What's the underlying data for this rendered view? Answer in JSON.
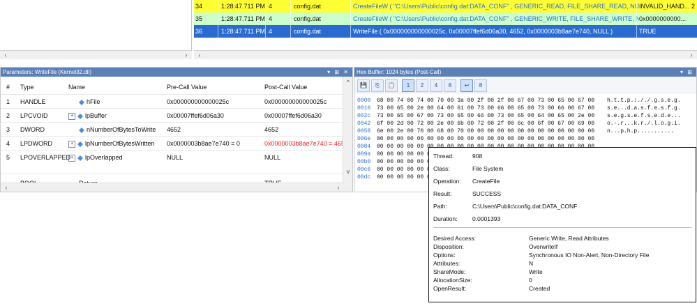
{
  "call_rows": [
    {
      "num": "34",
      "time": "1:28:47.711 PM",
      "thread": "4",
      "module": "config.dat",
      "api": "CreateFileW ( \"C:\\Users\\Public\\config.dat:DATA_CONF\" , GENERIC_READ, FILE_SHARE_READ, NULL, OPEN_EXISTING,..",
      "result": "INVALID_HAND...",
      "extra": "2"
    },
    {
      "num": "35",
      "time": "1:28:47.711 PM",
      "thread": "4",
      "module": "config.dat",
      "api": "CreateFileW ( \"C:\\Users\\Public\\config.dat:DATA_CONF\" , GENERIC_WRITE, FILE_SHARE_WRITE, NULL, CREATE_ALW...",
      "result": "0x0000000000...",
      "extra": ""
    },
    {
      "num": "36",
      "time": "1:28:47.711 PM",
      "thread": "4",
      "module": "config.dat",
      "api": "WriteFile ( 0x000000000000025c, 0x00007ffef6d06a30, 4652, 0x0000003b8ae7e740, NULL )",
      "result": "TRUE",
      "extra": ""
    }
  ],
  "parameters_panel": {
    "title": "Parameters: WriteFile (Kernel32.dll)",
    "controls": "▾ ⊞ ✕",
    "columns": [
      "#",
      "Type",
      "Name",
      "Pre-Call Value",
      "Post-Call Value"
    ],
    "rows": [
      {
        "n": "1",
        "type": "HANDLE",
        "expandable": false,
        "name": "hFile",
        "pre": "0x000000000000025c",
        "post": "0x000000000000025c",
        "changed": false
      },
      {
        "n": "2",
        "type": "LPCVOID",
        "expandable": true,
        "name": "lpBuffer",
        "pre": "0x00007ffef6d06a30",
        "post": "0x00007ffef6d06a30",
        "changed": false
      },
      {
        "n": "3",
        "type": "DWORD",
        "expandable": false,
        "name": "nNumberOfBytesToWrite",
        "pre": "4652",
        "post": "4652",
        "changed": false
      },
      {
        "n": "4",
        "type": "LPDWORD",
        "expandable": true,
        "name": "lpNumberOfBytesWritten",
        "pre": "0x0000003b8ae7e740 = 0",
        "post": "0x0000003b8ae7e740 = 4652",
        "changed": true
      },
      {
        "n": "5",
        "type": "LPOVERLAPPED",
        "expandable": true,
        "name": "lpOverlapped",
        "pre": "NULL",
        "post": "NULL",
        "changed": false
      }
    ],
    "partial_row": {
      "type": "BOOL",
      "name": "Return",
      "post": "TRUE"
    }
  },
  "hex_panel": {
    "title": "Hex Buffer: 1024 bytes (Post-Call)",
    "controls": "▾ ⊞",
    "toolbar": [
      "💾",
      "⎘",
      "📋",
      "1",
      "2",
      "4",
      "8",
      "↩",
      "8"
    ],
    "rows": [
      {
        "off": "0000",
        "bytes": "68 00 74 00 74 00 70 00 3a 00 2f 00 2f 00 67 00 73 00 65 00 67 00",
        "ascii": "h.t.t.p.:././.g.s.e.g."
      },
      {
        "off": "0016",
        "bytes": "73 00 65 00 2e 00 64 00 61 00 73 00 66 00 65 00 73 00 66 00 67 00",
        "ascii": "s.e...d.a.s.f.e.s.f.g."
      },
      {
        "off": "002c",
        "bytes": "73 00 65 00 67 00 73 00 65 00 66 00 73 00 65 00 64 00 65 00 2e 00",
        "ascii": "s.e.g.s.e.f.s.e.d.e..."
      },
      {
        "off": "0042",
        "bytes": "6f 00 2d 00 72 00 2e 00 6b 00 72 00 2f 00 6c 00 6f 00 67 00 69 00",
        "ascii": "o.-.r...k.r./.l.o.g.i."
      },
      {
        "off": "0058",
        "bytes": "6e 00 2e 00 70 00 68 00 70 00 00 00 00 00 00 00 00 00 00 00 00 00",
        "ascii": "n...p.h.p..........."
      },
      {
        "off": "006e",
        "bytes": "00 00 00 00 00 00 00 00 00 00 00 00 00 00 00 00 00 00 00 00 00 00",
        "ascii": ""
      },
      {
        "off": "0084",
        "bytes": "00 00 00 00 00 00 00 00 00 00 00 00 00 00 00 00 00 00 00 00 00 00",
        "ascii": ""
      },
      {
        "off": "009a",
        "bytes": "00 00 00 00 00 00 00 00 00 00 00 00 00 00 00 00 00 00 00 00 00 00",
        "ascii": ""
      },
      {
        "off": "00b0",
        "bytes": "00 00 00 00 00 00 00 00 00 00 00 00 00 00 00 00 00 00 00 00 00 00",
        "ascii": ""
      },
      {
        "off": "00c6",
        "bytes": "00 00 00 00 00 00 00 00 00 00 00 00 00 00 00 00 00 00 00 00 00 00",
        "ascii": ""
      },
      {
        "off": "00dc",
        "bytes": "00 00 00 00 00 00 00 00 00 00 00 00 00 00 00 00 00 00 00 00 00 00",
        "ascii": ""
      }
    ]
  },
  "event_properties": {
    "top": [
      {
        "label": "Thread:",
        "value": "908"
      },
      {
        "label": "Class:",
        "value": "File System"
      },
      {
        "label": "Operation:",
        "value": "CreateFile"
      },
      {
        "label": "Result:",
        "value": "SUCCESS"
      },
      {
        "label": "Path:",
        "value": "C:\\Users\\Public\\config.dat:DATA_CONF"
      },
      {
        "label": "Duration:",
        "value": "0.0001393"
      }
    ],
    "details": [
      {
        "label": "Desired Access:",
        "value": "Generic Write, Read Attributes"
      },
      {
        "label": "Disposition:",
        "value": "OverwriteIf"
      },
      {
        "label": "Options:",
        "value": "Synchronous IO Non-Alert, Non-Directory File"
      },
      {
        "label": "Attributes:",
        "value": "N"
      },
      {
        "label": "ShareMode:",
        "value": "Write"
      },
      {
        "label": "AllocationSize:",
        "value": "0"
      },
      {
        "label": "OpenResult:",
        "value": "Created"
      }
    ]
  },
  "scroll_glyphs": {
    "left": "‹",
    "right": "›",
    "up": "^",
    "down": "v"
  },
  "colors": {
    "row_yellow": "#ffff33",
    "row_green": "#ccffcc",
    "row_selected": "#2a6bd1",
    "panel_header": "#5b80b8",
    "changed_value": "#ff2020",
    "api_link": "#2a70d0"
  }
}
